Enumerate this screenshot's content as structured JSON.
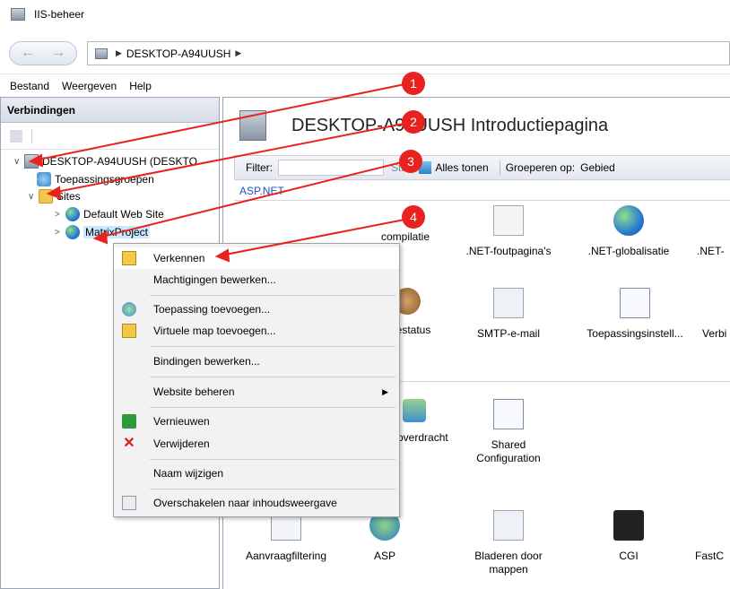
{
  "window": {
    "title": "IIS-beheer"
  },
  "address": {
    "path": "DESKTOP-A94UUSH"
  },
  "menubar": {
    "items": [
      "Bestand",
      "Weergeven",
      "Help"
    ]
  },
  "connections": {
    "title": "Verbindingen",
    "tree": {
      "server": "DESKTOP-A94UUSH (DESKTO",
      "app_pools": "Toepassingsgroepen",
      "sites": "Sites",
      "default_site": "Default Web Site",
      "selected_site": "MatrixProject"
    }
  },
  "main": {
    "heading": "DESKTOP-A94UUSH Introductiepagina",
    "filter": {
      "label": "Filter:",
      "start": "Start",
      "show_all": "Alles tonen",
      "group_by": "Groeperen op:",
      "group_value": "Gebied"
    },
    "group_aspnet": "ASP.NET",
    "features": [
      "compilatie",
      ".NET-foutpagina's",
      ".NET-globalisatie",
      ".NET-",
      "iestatus",
      "SMTP-e-mail",
      "Toepassingsinstell...",
      "Verbi",
      "overdracht",
      "Shared Configuration",
      "Aanvraagfiltering",
      "ASP",
      "Bladeren door mappen",
      "CGI",
      "FastC"
    ]
  },
  "context_menu": {
    "items": [
      "Verkennen",
      "Machtigingen bewerken...",
      "Toepassing toevoegen...",
      "Virtuele map toevoegen...",
      "Bindingen bewerken...",
      "Website beheren",
      "Vernieuwen",
      "Verwijderen",
      "Naam wijzigen",
      "Overschakelen naar inhoudsweergave"
    ]
  },
  "annotations": {
    "badges": [
      "1",
      "2",
      "3",
      "4"
    ],
    "color": "#e8231f"
  },
  "icons": {
    "back": "←",
    "forward": "→",
    "chevron": "▶",
    "submenu": "▶",
    "expanded": "∨",
    "collapsed": ">",
    "delete": "✕"
  }
}
